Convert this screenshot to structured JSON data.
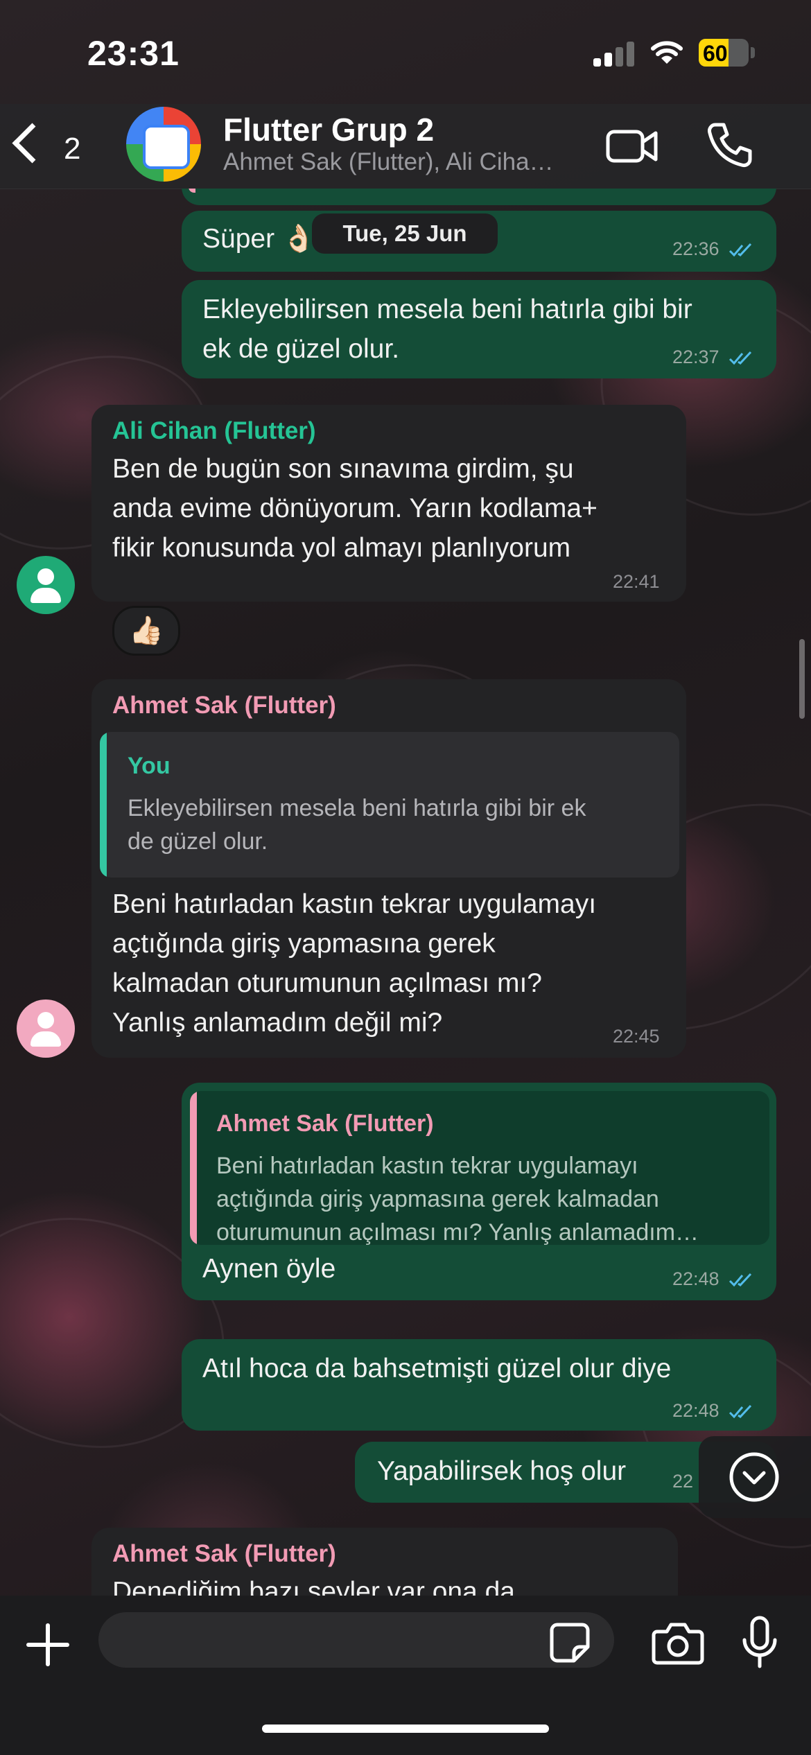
{
  "status_bar": {
    "time": "23:31",
    "battery": "60",
    "battery_level": 0.6
  },
  "header": {
    "back_count": "2",
    "group_name": "Flutter Grup 2",
    "members": "Ahmet Sak (Flutter), Ali Ciha…"
  },
  "date_chip": "Tue, 25 Jun",
  "colors": {
    "outgoing_bubble": "#144d37",
    "incoming_bubble": "#232325",
    "ali_name": "#25c495",
    "ahmet_name": "#f29bb4",
    "you_name": "#34c7a2",
    "read_ticks": "#53bdeb"
  },
  "messages": [
    {
      "text": "Süper 👌🏻",
      "time": "22:36",
      "direction": "out"
    },
    {
      "text": "Ekleyebilirsen mesela beni hatırla gibi bir\nek de güzel olur.",
      "time": "22:37",
      "direction": "out"
    },
    {
      "sender": "Ali Cihan (Flutter)",
      "text": "Ben de bugün son sınavıma girdim, şu\nanda evime dönüyorum. Yarın kodlama+\nfikir konusunda yol almayı planlıyorum",
      "time": "22:41",
      "direction": "in",
      "reaction": "👍🏻"
    },
    {
      "sender": "Ahmet Sak (Flutter)",
      "quote_name": "You",
      "quote_text": "Ekleyebilirsen mesela beni hatırla gibi bir ek\nde güzel olur.",
      "text": "Beni hatırladan kastın tekrar uygulamayı\naçtığında giriş yapmasına gerek\nkalmadan oturumunun açılması mı?\nYanlış anlamadım değil mi?",
      "time": "22:45",
      "direction": "in"
    },
    {
      "quote_name": "Ahmet Sak (Flutter)",
      "quote_text": "Beni hatırladan kastın tekrar uygulamayı\naçtığında giriş yapmasına gerek kalmadan\noturumunun açılması mı? Yanlış anlamadım…",
      "text": "Aynen öyle",
      "time": "22:48",
      "direction": "out"
    },
    {
      "text": "Atıl hoca da bahsetmişti güzel olur diye",
      "time": "22:48",
      "direction": "out"
    },
    {
      "text": "Yapabilirsek hoş olur",
      "time": "22",
      "direction": "out"
    },
    {
      "sender": "Ahmet Sak (Flutter)",
      "text": "Denediğim bazı şeyler var ona da",
      "direction": "in"
    }
  ],
  "composer": {
    "placeholder": ""
  }
}
